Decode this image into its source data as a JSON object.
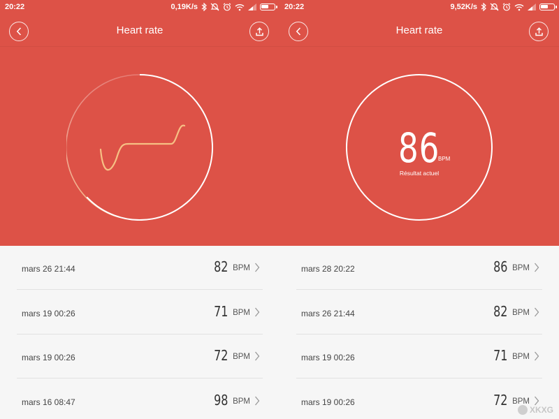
{
  "colors": {
    "header_red": "#dd5247",
    "list_bg": "#f6f6f6",
    "wave_orange": "#f6c084"
  },
  "screens": [
    {
      "status_bar": {
        "time": "20:22",
        "speed": "0,19K/s",
        "icons": [
          "bluetooth-icon",
          "mute-icon",
          "alarm-icon",
          "wifi-icon",
          "signal-icon",
          "battery-icon"
        ],
        "battery_level": 0.6
      },
      "header": {
        "title": "Heart rate",
        "back_icon": "chevron-left-icon",
        "share_icon": "upload-icon"
      },
      "measurement_state": "measuring",
      "progress": 0.63,
      "list": [
        {
          "date": "mars 26 21:44",
          "value": "82",
          "unit": "BPM"
        },
        {
          "date": "mars 19 00:26",
          "value": "71",
          "unit": "BPM"
        },
        {
          "date": "mars 19 00:26",
          "value": "72",
          "unit": "BPM"
        },
        {
          "date": "mars 16 08:47",
          "value": "98",
          "unit": "BPM"
        }
      ]
    },
    {
      "status_bar": {
        "time": "20:22",
        "speed": "9,52K/s",
        "icons": [
          "bluetooth-icon",
          "mute-icon",
          "alarm-icon",
          "wifi-icon",
          "signal-icon",
          "battery-icon"
        ],
        "battery_level": 0.6
      },
      "header": {
        "title": "Heart rate",
        "back_icon": "chevron-left-icon",
        "share_icon": "upload-icon"
      },
      "measurement_state": "result",
      "current": {
        "value": "86",
        "unit": "BPM",
        "label": "Résultat actuel"
      },
      "list": [
        {
          "date": "mars 28 20:22",
          "value": "86",
          "unit": "BPM"
        },
        {
          "date": "mars 26 21:44",
          "value": "82",
          "unit": "BPM"
        },
        {
          "date": "mars 19 00:26",
          "value": "71",
          "unit": "BPM"
        },
        {
          "date": "mars 19 00:26",
          "value": "72",
          "unit": "BPM"
        }
      ]
    }
  ],
  "watermark": "XKXG"
}
